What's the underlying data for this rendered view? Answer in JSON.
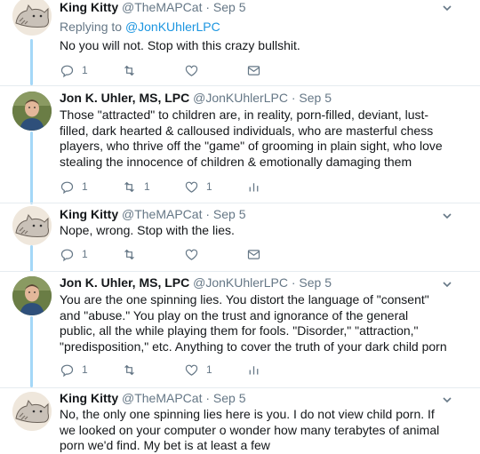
{
  "tweets": [
    {
      "name": "King Kitty",
      "handle": "@TheMAPCat",
      "dot": "·",
      "date": "Sep 5",
      "replying_prefix": "Replying to",
      "replying_to": "@JonKUhlerLPC",
      "text": "No you will not. Stop with this crazy bullshit.",
      "reply_count": "1",
      "retweet_count": "",
      "like_count": ""
    },
    {
      "name": "Jon K. Uhler, MS, LPC",
      "handle": "@JonKUhlerLPC",
      "dot": "·",
      "date": "Sep 5",
      "text": "Those \"attracted\" to children are, in reality, porn-filled, deviant, lust-filled, dark hearted & calloused individuals, who are masterful chess players, who thrive off the \"game\" of grooming in plain sight, who love stealing the innocence of children & emotionally damaging them",
      "reply_count": "1",
      "retweet_count": "1",
      "like_count": "1"
    },
    {
      "name": "King Kitty",
      "handle": "@TheMAPCat",
      "dot": "·",
      "date": "Sep 5",
      "text": "Nope, wrong. Stop with the lies.",
      "reply_count": "1",
      "retweet_count": "",
      "like_count": ""
    },
    {
      "name": "Jon K. Uhler, MS, LPC",
      "handle": "@JonKUhlerLPC",
      "dot": "·",
      "date": "Sep 5",
      "text": "You are the one spinning lies. You distort the language of \"consent\" and \"abuse.\" You play on the trust and ignorance of the general public, all the while playing them for fools. \"Disorder,\" \"attraction,\" \"predisposition,\" etc. Anything to cover the truth of your dark child porn",
      "reply_count": "1",
      "retweet_count": "",
      "like_count": "1"
    },
    {
      "name": "King Kitty",
      "handle": "@TheMAPCat",
      "dot": "·",
      "date": "Sep 5",
      "text": "No, the only one spinning lies here is you. I do not view child porn. If we looked on your computer o wonder how many terabytes of animal porn we'd find. My bet is at least a few"
    }
  ],
  "colors": {
    "text": "#14171a",
    "muted": "#657786",
    "link": "#1b95e0",
    "thread": "#a4d7f7",
    "divider": "#e6ecf0"
  }
}
